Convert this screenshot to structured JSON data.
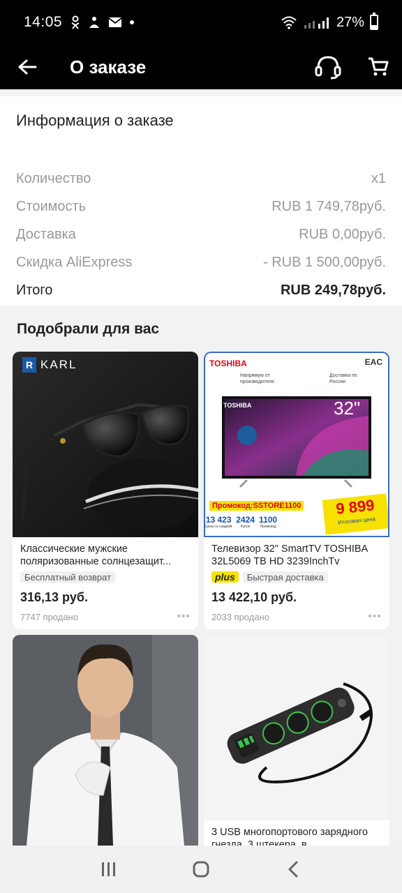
{
  "status_bar": {
    "time": "14:05",
    "battery_percent": "27%",
    "battery_level": 0.27
  },
  "app_bar": {
    "title": "О заказе"
  },
  "order_info": {
    "heading": "Информация о заказе",
    "rows": [
      {
        "label": "Количество",
        "value": "x1"
      },
      {
        "label": "Стоимость",
        "value": "RUB 1 749,78руб."
      },
      {
        "label": "Доставка",
        "value": "RUB 0,00руб."
      },
      {
        "label": "Скидка AliExpress",
        "value": "- RUB 1 500,00руб."
      }
    ],
    "total": {
      "label": "Итого",
      "value": "RUB 249,78руб."
    }
  },
  "recommendations": {
    "heading": "Подобрали для вас",
    "products": [
      {
        "brand": "KARL",
        "title": "Классические мужские поляризованные солнцезащит...",
        "badge": "Бесплатный возврат",
        "price": "316,13 руб.",
        "sold": "7747 продано"
      },
      {
        "brand": "TOSHIBA",
        "promo_text": {
          "feature_1": "Напрямую от производителя",
          "feature_2": "Доставка по России",
          "size": "32\"",
          "promocode": "Промокод:SSTORE1100",
          "calc_1": "13 423",
          "calc_1_caption": "Цена со скидкой",
          "calc_2": "2424",
          "calc_2_caption": "Купон",
          "calc_3": "1100",
          "calc_3_caption": "Промокод",
          "final_price": "9 899",
          "final_caption": "Итоговая цена",
          "certification": "EAC"
        },
        "title": "Телевизор 32\" SmartTV TOSHIBA 32L5069 TB HD 3239InchTv",
        "plus_label": "plus",
        "badge": "Быстрая доставка",
        "price": "13 422,10 руб.",
        "sold": "2033 продано"
      },
      {
        "title": ""
      },
      {
        "title": "3 USB многопортового зарядного гнезда, 3 штекера, в..."
      }
    ]
  },
  "colors": {
    "bar_background": "#000000",
    "card_background": "#ffffff",
    "page_background": "#f2f2f2",
    "plus_yellow": "#f7e100",
    "promo_red": "#e0001a"
  },
  "icons": [
    "back-arrow-icon",
    "headset-icon",
    "cart-icon",
    "recents-icon",
    "home-icon",
    "back-icon"
  ]
}
